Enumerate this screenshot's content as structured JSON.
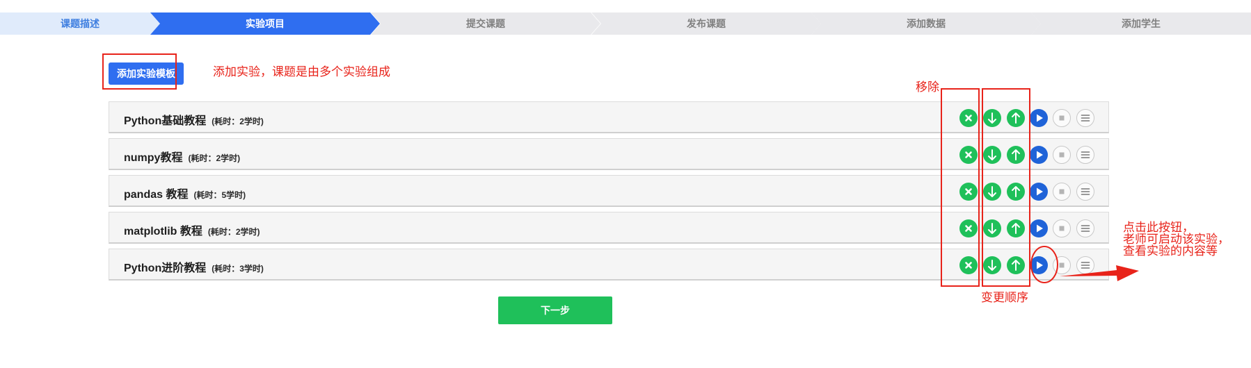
{
  "stepper": {
    "steps": [
      {
        "label": "课题描述",
        "state": "done"
      },
      {
        "label": "实验项目",
        "state": "active"
      },
      {
        "label": "提交课题",
        "state": "todo"
      },
      {
        "label": "发布课题",
        "state": "todo"
      },
      {
        "label": "添加数据",
        "state": "todo"
      },
      {
        "label": "添加学生",
        "state": "todo"
      }
    ]
  },
  "toolbar": {
    "add_template_label": "添加实验模板"
  },
  "experiments": [
    {
      "name": "Python基础教程",
      "duration": "(耗时：2学时)"
    },
    {
      "name": "numpy教程",
      "duration": "(耗时：2学时)"
    },
    {
      "name": "pandas 教程",
      "duration": "(耗时：5学时)"
    },
    {
      "name": "matplotlib 教程",
      "duration": "(耗时：2学时)"
    },
    {
      "name": "Python进阶教程",
      "duration": "(耗时：3学时)"
    }
  ],
  "row_controls": [
    "remove-icon",
    "arrow-down-icon",
    "arrow-up-icon",
    "play-icon",
    "stop-icon",
    "menu-icon"
  ],
  "footer": {
    "next_label": "下一步"
  },
  "annotations": {
    "add_note": "添加实验，课题是由多个实验组成",
    "remove_note": "移除",
    "order_note": "变更顺序",
    "play_note": "点击此按钮，\n老师可启动该实验，\n查看实验的内容等"
  },
  "colors": {
    "primary": "#2f6ef0",
    "success": "#1fc05a",
    "play": "#1f63d8",
    "annotation": "#e8231a",
    "step_done_bg": "#e0ebfb",
    "step_todo_bg": "#e9e9ec"
  }
}
